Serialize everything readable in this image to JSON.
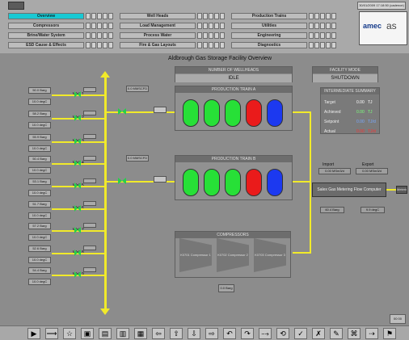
{
  "window": {
    "title": "Aldbrough Gas Storage Facility Overview",
    "top_clock": "30/01/2009 17:18:50 (cadence)",
    "logo_text": "amec",
    "logo_suffix": "as"
  },
  "nav": {
    "row1": [
      "Overview",
      "Well Heads",
      "Production Trains"
    ],
    "row2": [
      "Compressors",
      "Load Management",
      "Utilities"
    ],
    "row3": [
      "Brine/Water System",
      "Process Water",
      "Engineering"
    ],
    "row4": [
      "ESD Cause & Effects",
      "Fire & Gas Layouts",
      "Diagnostics"
    ]
  },
  "status": {
    "top_panel_title": "NUMBER OF WELLHEADS",
    "top_panel_value": "IDLE",
    "facility_title": "FACILITY MODE",
    "facility_value": "SHUTDOWN"
  },
  "summary": {
    "title": "INTERMEDIATE SUMMARY",
    "rows": [
      {
        "label": "Target",
        "value": "0.00",
        "unit": "TJ",
        "color": "#ffffff"
      },
      {
        "label": "Achieved",
        "value": "0.00",
        "unit": "TJ",
        "color": "#7CFF7C"
      },
      {
        "label": "Setpoint",
        "value": "0.00",
        "unit": "TJ/d",
        "color": "#78a8ff"
      },
      {
        "label": "Actual",
        "value": "0.00",
        "unit": "TJ/d",
        "color": "#ff3030"
      }
    ]
  },
  "wells": [
    {
      "name": "Well 1",
      "pressure": "50.0 Barg",
      "temp": "10.0 degC"
    },
    {
      "name": "Well 2",
      "pressure": "58.2 Barg",
      "temp": "10.0 degC"
    },
    {
      "name": "Well 3",
      "pressure": "55.9 Barg",
      "temp": "10.0 degC"
    },
    {
      "name": "Well 4",
      "pressure": "50.4 Barg",
      "temp": "10.0 degC"
    },
    {
      "name": "Well 5",
      "pressure": "53.1 Barg",
      "temp": "10.0 degC"
    },
    {
      "name": "Well 6",
      "pressure": "51.7 Barg",
      "temp": "10.0 degC"
    },
    {
      "name": "Well 7",
      "pressure": "57.2 Barg",
      "temp": "10.0 degC"
    },
    {
      "name": "Well 8",
      "pressure": "52.6 Barg",
      "temp": "10.0 degC"
    },
    {
      "name": "Well 9",
      "pressure": "54.4 Barg",
      "temp": "10.0 degC"
    }
  ],
  "trains": [
    {
      "name": "PRODUCTION TRAIN A",
      "flow": "0.0 MMSCFD",
      "vessels": [
        "green",
        "green",
        "green",
        "red",
        "blue"
      ]
    },
    {
      "name": "PRODUCTION TRAIN B",
      "flow": "0.0 MMSCFD",
      "vessels": [
        "green",
        "green",
        "green",
        "red",
        "blue"
      ]
    }
  ],
  "compressors": {
    "title": "COMPRESSORS",
    "units": [
      "K0701 Compressor 1",
      "K0702 Compressor 2",
      "K0703 Compressor 3"
    ],
    "discharge": "0.0 Barg"
  },
  "metering": {
    "title": "Salex Gas Metering Flow Computer",
    "import_label": "Import",
    "export_label": "Export",
    "import_value": "0.00 MSm3/d",
    "export_value": "0.00 MSm3/d",
    "pressure": "60.4 Barg",
    "temp": "9.9 degC",
    "metering_label": "Metering"
  },
  "bottom": {
    "tools": [
      "▶",
      "⟶",
      "☆",
      "▣",
      "▤",
      "▥",
      "▦",
      "⇦",
      "⇧",
      "⇩",
      "⇨",
      "↶",
      "↷",
      "⤍",
      "⟲",
      "✓",
      "✗",
      "✎",
      "⌘",
      "⇢",
      "⚑"
    ],
    "corner": "00 00"
  }
}
